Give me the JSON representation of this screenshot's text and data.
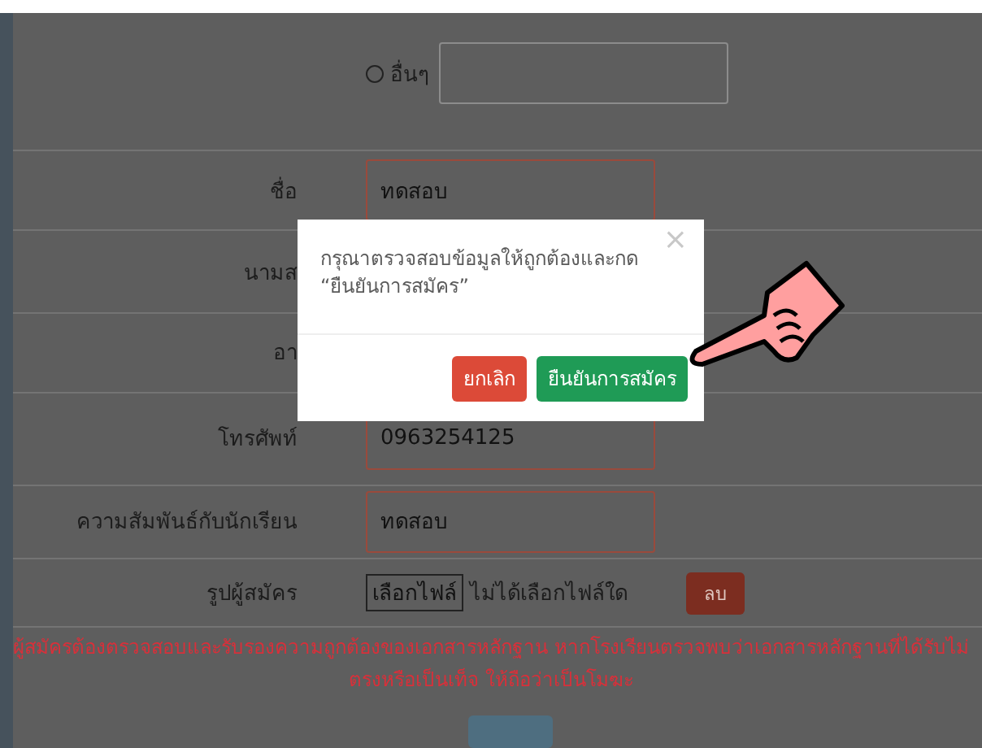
{
  "form": {
    "other_option": {
      "label": "อื่นๆ",
      "selected": false
    },
    "rows": [
      {
        "kind": "input",
        "label": "ชื่อ",
        "value": "ทดสอบ"
      },
      {
        "kind": "empty",
        "label": "นามส"
      },
      {
        "kind": "empty",
        "label": "อา"
      },
      {
        "kind": "input",
        "label": "โทรศัพท์",
        "value": "0963254125"
      },
      {
        "kind": "input",
        "label": "ความสัมพันธ์กับนักเรียน",
        "value": "ทดสอบ"
      },
      {
        "kind": "file",
        "label": "รูปผู้สมัคร",
        "button": "เลือกไฟล์",
        "status": "ไม่ได้เลือกไฟล์ใด",
        "delete": "ลบ"
      }
    ],
    "notice": "ผู้สมัครต้องตรวจสอบและรับรองความถูกต้องของเอกสารหลักฐาน หากโรงเรียนตรวจพบว่าเอกสารหลักฐานที่ได้รับไม่ตรงหรือเป็นเท็จ ให้ถือว่าเป็นโมฆะ"
  },
  "dialog": {
    "message": "กรุณาตรวจสอบข้อมูลให้ถูกต้องและกด “ยืนยันการสมัคร”",
    "close": "×",
    "buttons": [
      {
        "kind": "cancel",
        "label": "ยกเลิก"
      },
      {
        "kind": "confirm",
        "label": "ยืนยันการสมัคร"
      }
    ]
  }
}
